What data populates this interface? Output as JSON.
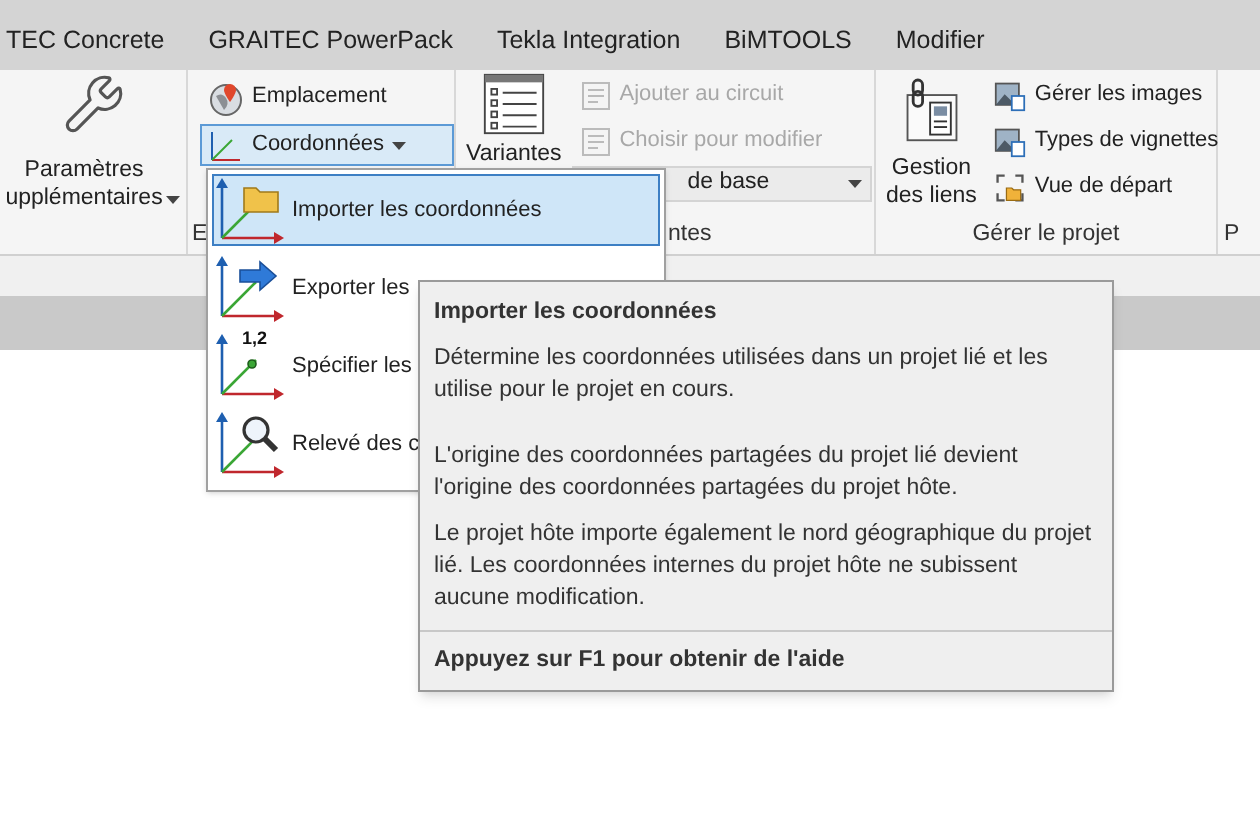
{
  "tabs": [
    {
      "label": "TEC Concrete",
      "selected": false
    },
    {
      "label": "GRAITEC PowerPack",
      "selected": false
    },
    {
      "label": "Tekla Integration",
      "selected": false
    },
    {
      "label": "BiMTOOLS",
      "selected": false
    },
    {
      "label": "Modifier",
      "selected": false
    }
  ],
  "ribbon": {
    "panels": [
      {
        "buttons": [
          {
            "kind": "large",
            "lines": [
              "Paramètres",
              "upplémentaires"
            ],
            "has_menu": true
          }
        ]
      },
      {
        "label": "E",
        "buttons": [
          {
            "kind": "small",
            "label": "Emplacement"
          },
          {
            "kind": "small",
            "label": "Coordonnées",
            "active": true,
            "has_menu": true
          }
        ]
      },
      {
        "label": "ntes",
        "buttons": [
          {
            "kind": "large",
            "lines": [
              "Variantes"
            ]
          },
          {
            "kind": "small",
            "label": "Ajouter au circuit",
            "disabled": true
          },
          {
            "kind": "small",
            "label": "Choisir pour modifier",
            "disabled": true
          },
          {
            "kind": "combo",
            "value": "de base"
          }
        ]
      },
      {
        "label": "Gérer le projet",
        "buttons": [
          {
            "kind": "large",
            "lines": [
              "Gestion",
              "des liens"
            ]
          },
          {
            "kind": "small",
            "label": "Gérer les images"
          },
          {
            "kind": "small",
            "label": "Types de vignettes"
          },
          {
            "kind": "small",
            "label": "Vue de départ"
          }
        ]
      },
      {
        "label": "P"
      }
    ]
  },
  "menu": {
    "items": [
      {
        "label": "Importer les coordonnées",
        "selected": true
      },
      {
        "label": "Exporter les",
        "selected": false
      },
      {
        "label": "Spécifier les",
        "selected": false,
        "icon_text": "1,2"
      },
      {
        "label": "Relevé des c",
        "selected": false
      }
    ]
  },
  "tooltip": {
    "title": "Importer les coordonnées",
    "paragraphs": [
      "Détermine les coordonnées utilisées dans un projet lié et les utilise pour le projet en cours.",
      "L'origine des coordonnées partagées du projet lié devient l'origine des coordonnées partagées du projet hôte.",
      "Le projet hôte importe également le nord géographique du projet lié. Les coordonnées internes du projet hôte ne subissent aucune modification."
    ],
    "footer": "Appuyez sur F1 pour obtenir de l'aide"
  }
}
